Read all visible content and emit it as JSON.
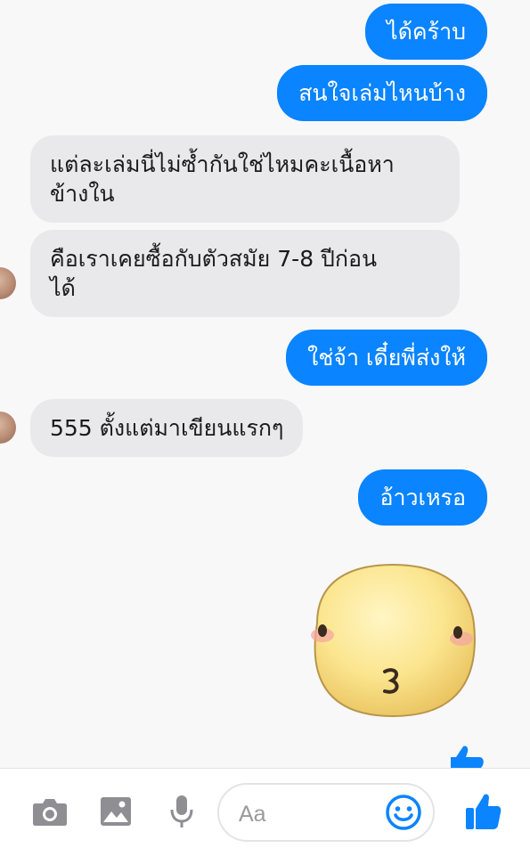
{
  "chat": {
    "messages": [
      {
        "side": "out",
        "text": "ได้คร้าบ"
      },
      {
        "side": "out",
        "text": "สนใจเล่มไหนบ้าง"
      },
      {
        "side": "in",
        "lines": [
          "แต่ละเล่มนี่ไม่ซ้ำกันใช่ไหมคะเนื้อหา",
          "ข้างใน"
        ]
      },
      {
        "side": "in",
        "lines": [
          "คือเราเคยซื้อกับตัวสมัย 7-8 ปีก่อน",
          "ได้"
        ]
      },
      {
        "side": "out",
        "text": "ใช่จ้า เดี๋ยพี่ส่งให้"
      },
      {
        "side": "in",
        "text": "555 ตั้งแต่มาเขียนแรกๆ"
      },
      {
        "side": "out",
        "text": "อ้าวเหรอ"
      }
    ],
    "sticker": "blushing-face-sticker"
  },
  "composer": {
    "placeholder": "Aa",
    "icons": [
      "camera-icon",
      "image-icon",
      "microphone-icon",
      "smiley-icon",
      "thumbs-up-icon"
    ]
  },
  "colors": {
    "outgoing_bubble": "#0a84ff",
    "incoming_bubble": "#e9e9eb",
    "icon_gray": "#8e8e93",
    "accent": "#0a84ff"
  }
}
